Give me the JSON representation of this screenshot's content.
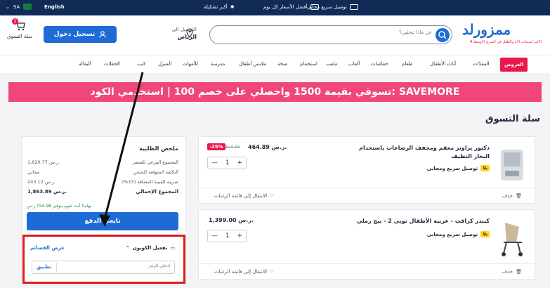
{
  "topbar": {
    "region": "SA",
    "language": "English",
    "promos": [
      "توصيل سريع مجاني",
      "أفضل الأسعار كل يوم",
      "أكبر تشكيلة"
    ]
  },
  "header": {
    "cart_label": "سلة التسوق",
    "cart_count": "2",
    "login_label": "تسجيل دخول",
    "deliver_to": "التوصيل الى",
    "city": "الرياض",
    "search_placeholder": "عن ماذا تبحثين؟",
    "logo_text": "ممزورلد",
    "logo_tagline": "# الأكبر لمنتجات الأم والطفل في الشرق الأوسط"
  },
  "nav": {
    "deals": "العروض",
    "items": [
      "المعدّات",
      "أثاث الأطفال",
      "طعام",
      "حفاضات",
      "ألعاب",
      "ملعب",
      "استحمام",
      "صحة",
      "ملابس أطفال",
      "مدرسة",
      "للأمهات",
      "المنزل",
      "كتب",
      "الحفلات",
      "البقالة"
    ]
  },
  "banner": "تسوقي بقيمة 1500 واحصلي على خصم 100 | استخدمي الكود: SAVEMORE",
  "page_title": "سلة التسوق",
  "products": [
    {
      "title": "دكتور براونز معقم ومجفف الرضاعات باستخدام البخار النظيف",
      "price": "464.89 ر.س.",
      "old_price": "619.85",
      "discount": "-25%",
      "shipping": "توصيل سريع ومجاني",
      "badge": "يلا",
      "qty": "1",
      "wishlist": "الانتقال إلى قائمة الرغبات",
      "delete": "حذف"
    },
    {
      "title": "كيندر كرافت - عربية الأطفال نوبي 2 - بيج رملي",
      "price": "1,399.00 ر.س.",
      "shipping": "توصيل سريع ومجاني",
      "badge": "يلا",
      "qty": "1",
      "wishlist": "الانتقال إلى قائمة الرغبات",
      "delete": "حذف"
    }
  ],
  "summary": {
    "title": "ملخص الطلبية",
    "rows": [
      {
        "label": "المجموع الفرعي للعنصر",
        "value": "1,620.77 ر.س."
      },
      {
        "label": "التكلفة المتوقعة للشحن",
        "value": "مجاني"
      },
      {
        "label": "ضريبة القيمة المضافة (15%)",
        "value": "243.12 ر.س."
      },
      {
        "label": "المجموع الإجمالي",
        "value": "1,863.89 ر.س."
      }
    ],
    "savings": "تهانيا! أنت تقوم بتوفير 154.96 ر.س.",
    "checkout": "تابعي الدفع"
  },
  "coupon": {
    "activate": "تفعيل الكوبون",
    "show_coupons": "عرض القسائم",
    "placeholder": "ادخلي الرمز",
    "apply": "تطبيق"
  },
  "colors": {
    "navy": "#0f2b56",
    "primary": "#1e6bd6",
    "pink": "#e8184a",
    "banner": "#f04778",
    "highlight": "#e31b1b"
  }
}
